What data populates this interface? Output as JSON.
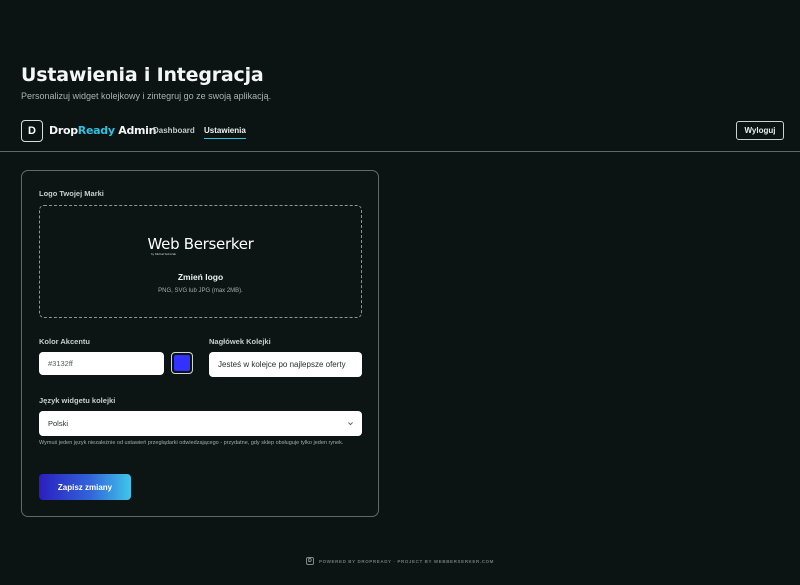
{
  "header": {
    "title": "Ustawienia i Integracja",
    "subtitle": "Personalizuj widget kolejkowy i zintegruj go ze swoją aplikacją."
  },
  "nav": {
    "logo_letter": "D",
    "brand_prefix": "Drop",
    "brand_accent": "Ready",
    "brand_suffix": " Admin",
    "links": [
      {
        "label": "Dashboard",
        "active": false
      },
      {
        "label": "Ustawienia",
        "active": true
      }
    ],
    "logout_label": "Wyloguj"
  },
  "form": {
    "logo_section_label": "Logo Twojej Marki",
    "logo_preview_text": "Web Berserker",
    "logo_preview_subtext": "by Michał Sobczak",
    "change_logo_label": "Zmień logo",
    "logo_hint": "PNG, SVG lub JPG (max 2MB).",
    "accent_label": "Kolor Akcentu",
    "accent_value": "#3132ff",
    "accent_color": "#3132ff",
    "queue_header_label": "Nagłówek Kolejki",
    "queue_header_value": "Jesteś w kolejce po najlepsze oferty",
    "language_label": "Język widgetu kolejki",
    "language_value": "Polski",
    "language_note": "Wymuś jeden język niezależnie od ustawień przeglądarki odwiedzającego - przydatne, gdy sklep obsługuje tylko jeden rynek.",
    "save_label": "Zapisz zmiany"
  },
  "footer": {
    "logo_letter": "D",
    "text": "POWERED BY DROPREADY · PROJECT BY WEBBERSERKER.COM"
  },
  "colors": {
    "background": "#0b1313",
    "accent_cyan": "#2fc2e0",
    "button_gradient_start": "#2a1fbf",
    "button_gradient_end": "#3ec7ea"
  }
}
